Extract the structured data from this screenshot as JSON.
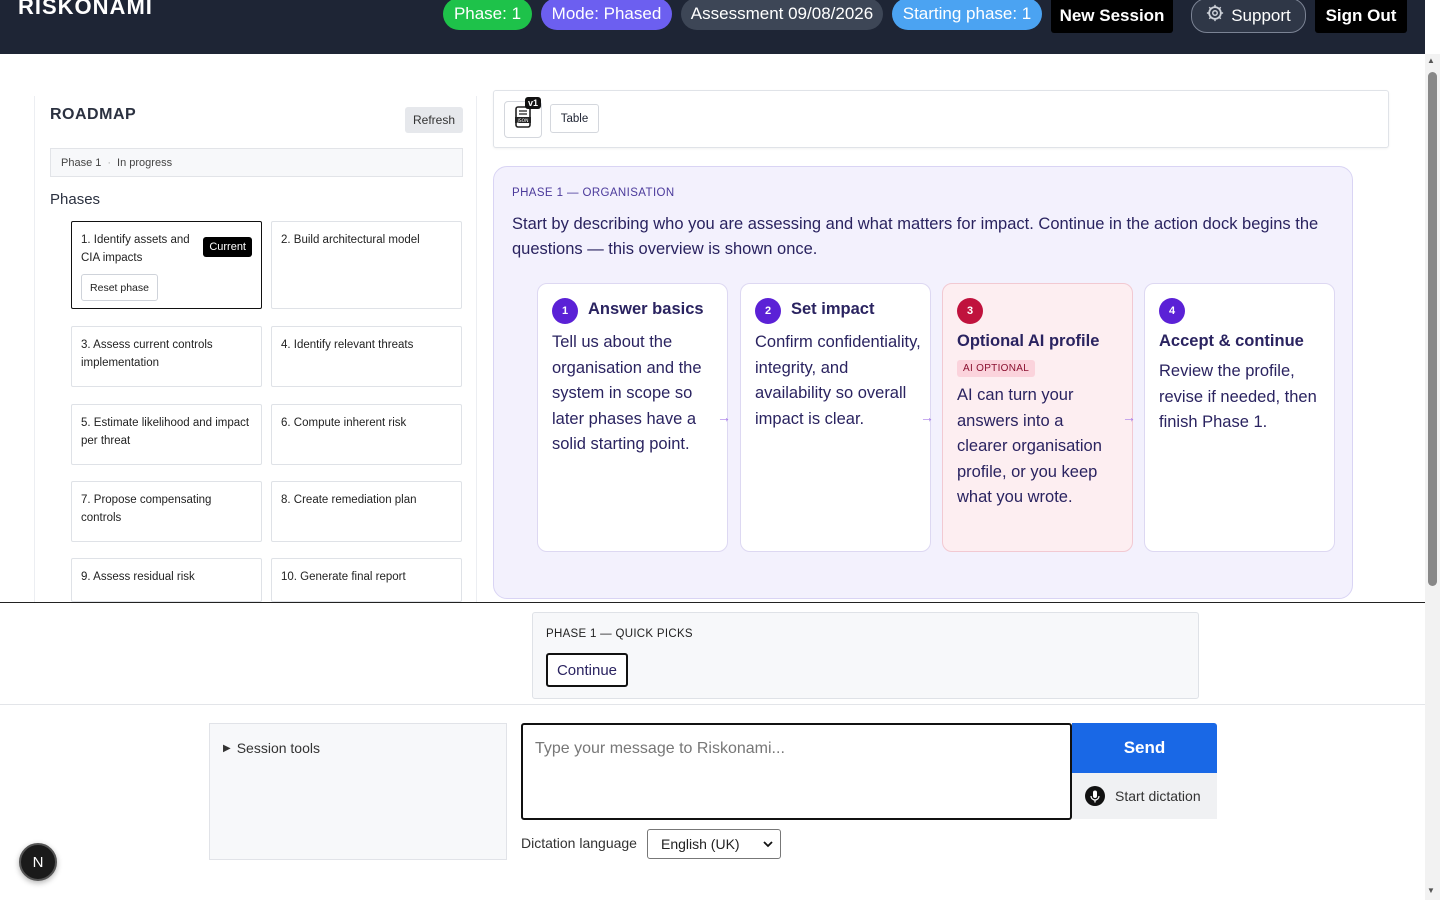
{
  "header": {
    "brand": "RISKONAMI",
    "phase_pill": "Phase: 1",
    "mode_pill": "Mode: Phased",
    "assessment_pill": "Assessment 09/08/2026",
    "starting_phase_pill": "Starting phase: 1",
    "new_session_label": "New Session",
    "support_label": "Support",
    "sign_out_label": "Sign Out"
  },
  "roadmap": {
    "title": "ROADMAP",
    "refresh_label": "Refresh",
    "status_phase": "Phase 1",
    "status_separator": "·",
    "status_state": "In progress",
    "phases_heading": "Phases",
    "current_badge": "Current",
    "reset_label": "Reset phase",
    "phases": [
      {
        "label": "1. Identify assets and CIA impacts"
      },
      {
        "label": "2. Build architectural model"
      },
      {
        "label": "3. Assess current controls implementation"
      },
      {
        "label": "4. Identify relevant threats"
      },
      {
        "label": "5. Estimate likelihood and impact per threat"
      },
      {
        "label": "6. Compute inherent risk"
      },
      {
        "label": "7. Propose compensating controls"
      },
      {
        "label": "8. Create remediation plan"
      },
      {
        "label": "9. Assess residual risk"
      },
      {
        "label": "10. Generate final report"
      }
    ]
  },
  "toolbar": {
    "version_badge": "v1",
    "json_icon": "json-file-icon",
    "table_label": "Table"
  },
  "phase_panel": {
    "kicker": "PHASE 1 — ORGANISATION",
    "intro": "Start by describing who you are assessing and what matters for impact. Continue in the action dock begins the questions — this overview is shown once.",
    "arrow": "→",
    "steps": [
      {
        "num": "1",
        "title": "Answer basics",
        "body": "Tell us about the organisation and the system in scope so later phases have a solid starting point."
      },
      {
        "num": "2",
        "title": "Set impact",
        "body": "Confirm confidentiality, integrity, and availability so overall impact is clear."
      },
      {
        "num": "3",
        "title": "Optional AI profile",
        "tag": "AI OPTIONAL",
        "body": "AI can turn your answers into a clearer organisation profile, or you keep what you wrote."
      },
      {
        "num": "4",
        "title": "Accept & continue",
        "body": "Review the profile, revise if needed, then finish Phase 1."
      }
    ]
  },
  "quick_picks": {
    "title": "PHASE 1 — QUICK PICKS",
    "continue_label": "Continue"
  },
  "dock": {
    "session_tools_label": "Session tools",
    "message_placeholder": "Type your message to Riskonami...",
    "send_label": "Send",
    "dictation_label": "Start dictation",
    "dictation_language_label": "Dictation language",
    "dictation_language_value": "English (UK)"
  },
  "floating_badge": "N",
  "colors": {
    "header_bg": "#1e2535",
    "phase_pill": "#1ec24a",
    "mode_pill": "#6c5ff0",
    "starting_pill": "#4ba3f2",
    "send_button": "#1968e6",
    "step_number": "#5b21d6",
    "ai_step_number": "#c0123d"
  }
}
